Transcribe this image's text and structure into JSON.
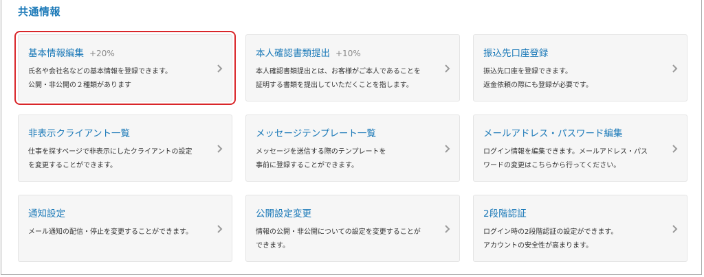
{
  "section_title": "共通情報",
  "icons": {
    "chevron": "chevron-right-icon"
  },
  "colors": {
    "link": "#1b79b8",
    "highlight": "#d9262a"
  },
  "cards": [
    {
      "title": "基本情報編集",
      "badge": "+20%",
      "description": "氏名や会社名などの基本情報を登録できます。\n公開・非公開の２種類があります",
      "highlighted": true
    },
    {
      "title": "本人確認書類提出",
      "badge": "+10%",
      "description": "本人確認書類提出とは、お客様がご本人であることを\n証明する書類を提出していただくことを指します。"
    },
    {
      "title": "振込先口座登録",
      "badge": "",
      "description": "振込先口座を登録できます。\n返金依頼の際にも登録が必要です。"
    },
    {
      "title": "非表示クライアント一覧",
      "badge": "",
      "description": "仕事を探すページで非表示にしたクライアントの設定\nを変更することができます。"
    },
    {
      "title": "メッセージテンプレート一覧",
      "badge": "",
      "description": "メッセージを送信する際のテンプレートを\n事前に登録することができます。"
    },
    {
      "title": "メールアドレス・パスワード編集",
      "badge": "",
      "description": "ログイン情報を編集できます。メールアドレス・パス\nワードの変更はこちらから行ってください。"
    },
    {
      "title": "通知設定",
      "badge": "",
      "description": "メール通知の配信・停止を変更することができます。"
    },
    {
      "title": "公開設定変更",
      "badge": "",
      "description": "情報の公開・非公開についての設定を変更することが\nできます。"
    },
    {
      "title": "2段階認証",
      "badge": "",
      "description": "ログイン時の2段階認証の設定ができます。\nアカウントの安全性が高まります。"
    }
  ]
}
